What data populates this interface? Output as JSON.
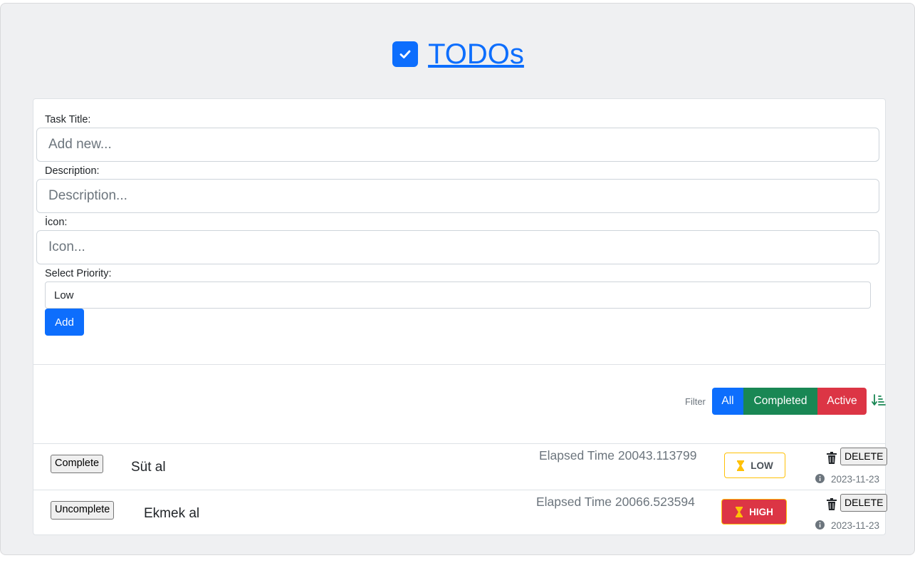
{
  "header": {
    "title": "TODOs",
    "icon": "checkbox-icon"
  },
  "form": {
    "title_label": "Task Title:",
    "title_placeholder": "Add new...",
    "description_label": "Description:",
    "description_placeholder": "Description...",
    "icon_label": "İcon:",
    "icon_placeholder": "Icon...",
    "priority_label": "Select Priority:",
    "priority_value": "Low",
    "add_label": "Add"
  },
  "filter": {
    "label": "Filter",
    "buttons": [
      {
        "label": "All",
        "color": "#0d6efd"
      },
      {
        "label": "Completed",
        "color": "#198754"
      },
      {
        "label": "Active",
        "color": "#dc3545"
      }
    ],
    "sort_icon": "sort-down-icon"
  },
  "todos": [
    {
      "toggle_label": "Complete",
      "title": "Süt al",
      "elapsed": "Elapsed Time 20043.113799",
      "priority": "LOW",
      "delete_label": "DELETE",
      "date": "2023-11-23"
    },
    {
      "toggle_label": "Uncomplete",
      "title": "Ekmek al",
      "elapsed": "Elapsed Time 20066.523594",
      "priority": "HIGH",
      "delete_label": "DELETE",
      "date": "2023-11-23"
    }
  ],
  "colors": {
    "primary": "#0d6efd",
    "success": "#198754",
    "danger": "#dc3545",
    "warning": "#ffc107",
    "background": "#eff0f2"
  }
}
